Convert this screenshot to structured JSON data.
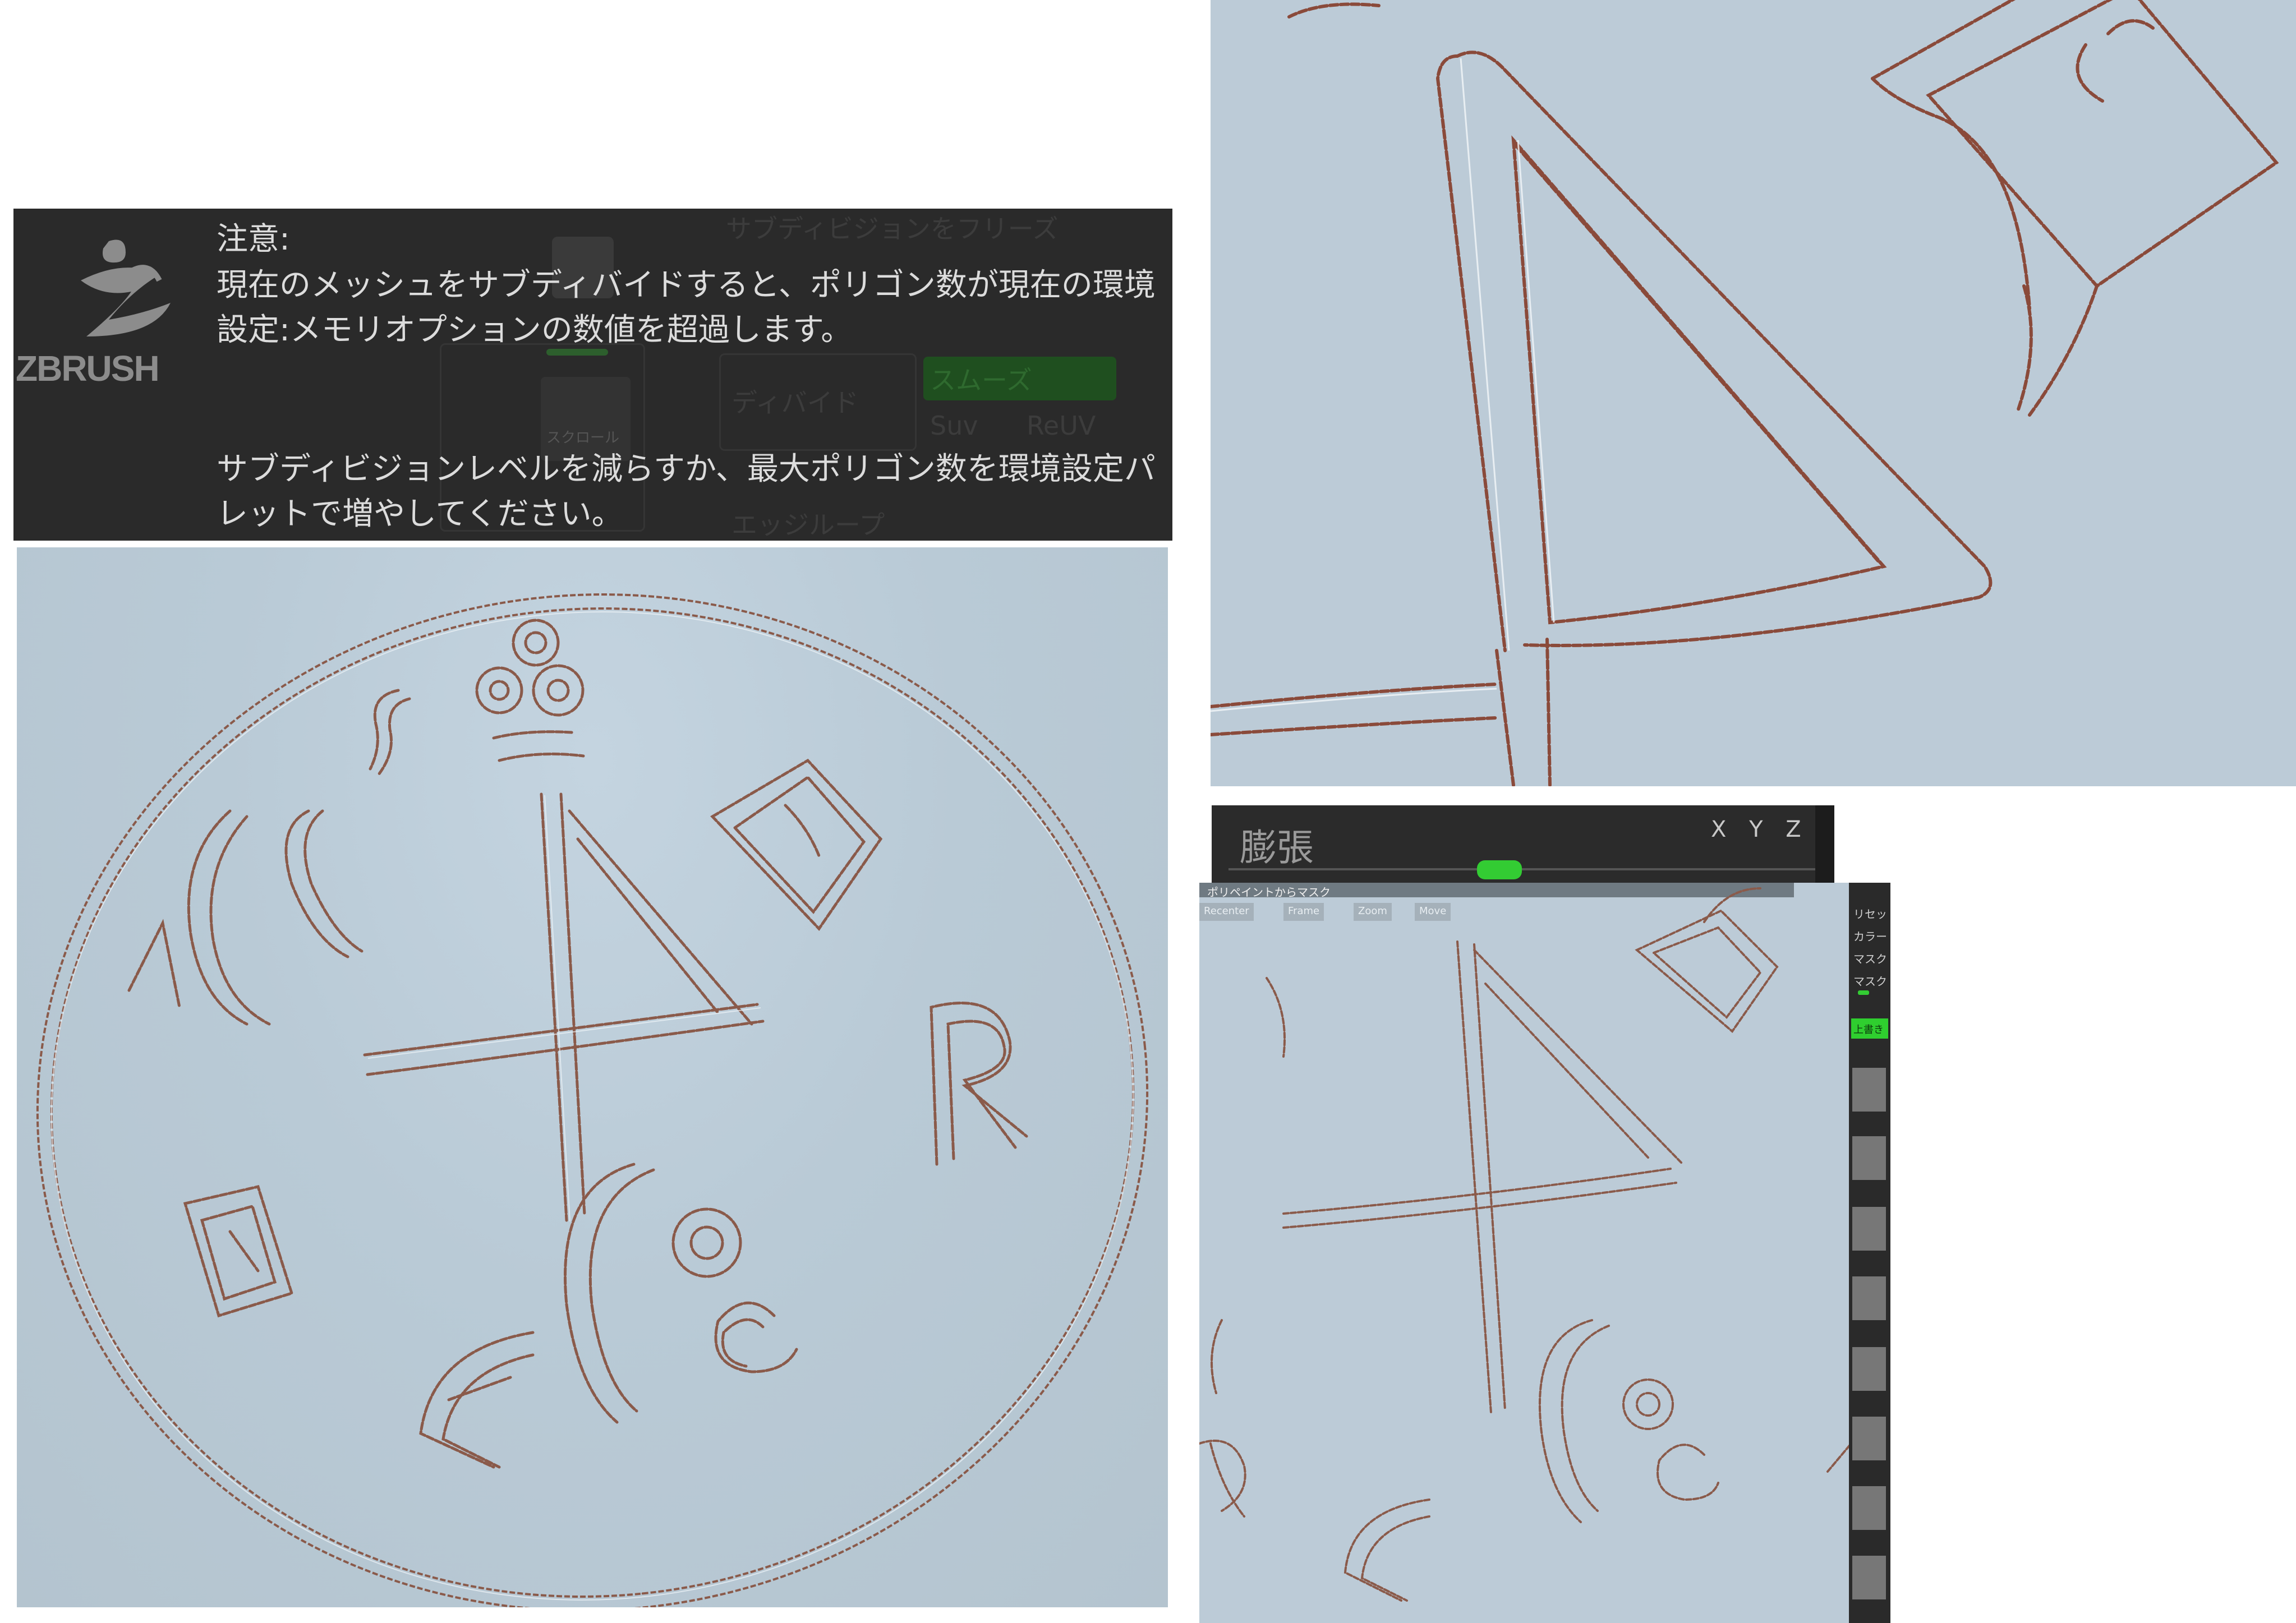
{
  "dialog": {
    "logo_text": "ZBRUSH",
    "heading": "注意:",
    "message_line1": "現在のメッシュをサブディバイドすると、ポリゴン数が現在の環境",
    "message_line2": "設定:メモリオプションの数値を超過します。",
    "advice_line1": "サブディビジョンレベルを減らすか、最大ポリゴン数を環境設定パ",
    "advice_line2": "レットで増やしてください。",
    "background": {
      "freeze_label": "サブディビジョンをフリーズ",
      "divide_label": "ディバイド",
      "smooth_label": "スムーズ",
      "suv_label": "Suv",
      "reuv_label": "ReUV",
      "edgeloop_label": "エッジループ",
      "scroll_label": "スクロール"
    }
  },
  "panel": {
    "title": "膨張",
    "axis_icons": "X Y Z",
    "slider_value_fraction": 0.46,
    "accent_color": "#33cc33"
  },
  "small_viewport": {
    "title_bar": "ポリペイントからマスク",
    "nav": [
      "Recenter",
      "Frame",
      "Zoom",
      "Move"
    ]
  },
  "side_panel": {
    "items": [
      "リセッ",
      "カラー",
      "マスク",
      "マスク"
    ],
    "button_label": "上書き"
  },
  "colors": {
    "viewport_bg": "#b9cad6",
    "engrave_dark": "#8a5a4a",
    "engrave_light": "#eef4f8",
    "dialog_bg": "#2a2a2a"
  }
}
